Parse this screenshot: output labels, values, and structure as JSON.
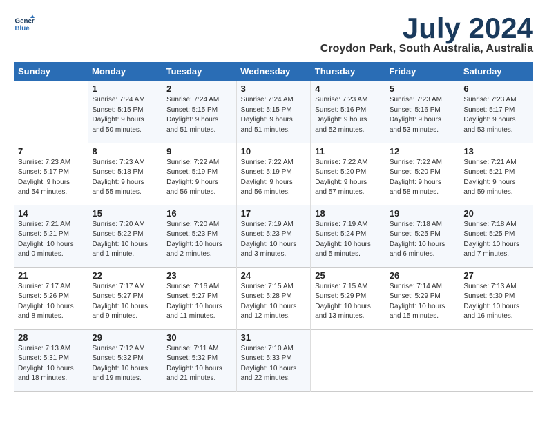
{
  "logo": {
    "line1": "General",
    "line2": "Blue"
  },
  "title": "July 2024",
  "location": "Croydon Park, South Australia, Australia",
  "days_of_week": [
    "Sunday",
    "Monday",
    "Tuesday",
    "Wednesday",
    "Thursday",
    "Friday",
    "Saturday"
  ],
  "weeks": [
    [
      {
        "day": "",
        "info": ""
      },
      {
        "day": "1",
        "info": "Sunrise: 7:24 AM\nSunset: 5:15 PM\nDaylight: 9 hours\nand 50 minutes."
      },
      {
        "day": "2",
        "info": "Sunrise: 7:24 AM\nSunset: 5:15 PM\nDaylight: 9 hours\nand 51 minutes."
      },
      {
        "day": "3",
        "info": "Sunrise: 7:24 AM\nSunset: 5:15 PM\nDaylight: 9 hours\nand 51 minutes."
      },
      {
        "day": "4",
        "info": "Sunrise: 7:23 AM\nSunset: 5:16 PM\nDaylight: 9 hours\nand 52 minutes."
      },
      {
        "day": "5",
        "info": "Sunrise: 7:23 AM\nSunset: 5:16 PM\nDaylight: 9 hours\nand 53 minutes."
      },
      {
        "day": "6",
        "info": "Sunrise: 7:23 AM\nSunset: 5:17 PM\nDaylight: 9 hours\nand 53 minutes."
      }
    ],
    [
      {
        "day": "7",
        "info": "Sunrise: 7:23 AM\nSunset: 5:17 PM\nDaylight: 9 hours\nand 54 minutes."
      },
      {
        "day": "8",
        "info": "Sunrise: 7:23 AM\nSunset: 5:18 PM\nDaylight: 9 hours\nand 55 minutes."
      },
      {
        "day": "9",
        "info": "Sunrise: 7:22 AM\nSunset: 5:19 PM\nDaylight: 9 hours\nand 56 minutes."
      },
      {
        "day": "10",
        "info": "Sunrise: 7:22 AM\nSunset: 5:19 PM\nDaylight: 9 hours\nand 56 minutes."
      },
      {
        "day": "11",
        "info": "Sunrise: 7:22 AM\nSunset: 5:20 PM\nDaylight: 9 hours\nand 57 minutes."
      },
      {
        "day": "12",
        "info": "Sunrise: 7:22 AM\nSunset: 5:20 PM\nDaylight: 9 hours\nand 58 minutes."
      },
      {
        "day": "13",
        "info": "Sunrise: 7:21 AM\nSunset: 5:21 PM\nDaylight: 9 hours\nand 59 minutes."
      }
    ],
    [
      {
        "day": "14",
        "info": "Sunrise: 7:21 AM\nSunset: 5:21 PM\nDaylight: 10 hours\nand 0 minutes."
      },
      {
        "day": "15",
        "info": "Sunrise: 7:20 AM\nSunset: 5:22 PM\nDaylight: 10 hours\nand 1 minute."
      },
      {
        "day": "16",
        "info": "Sunrise: 7:20 AM\nSunset: 5:23 PM\nDaylight: 10 hours\nand 2 minutes."
      },
      {
        "day": "17",
        "info": "Sunrise: 7:19 AM\nSunset: 5:23 PM\nDaylight: 10 hours\nand 3 minutes."
      },
      {
        "day": "18",
        "info": "Sunrise: 7:19 AM\nSunset: 5:24 PM\nDaylight: 10 hours\nand 5 minutes."
      },
      {
        "day": "19",
        "info": "Sunrise: 7:18 AM\nSunset: 5:25 PM\nDaylight: 10 hours\nand 6 minutes."
      },
      {
        "day": "20",
        "info": "Sunrise: 7:18 AM\nSunset: 5:25 PM\nDaylight: 10 hours\nand 7 minutes."
      }
    ],
    [
      {
        "day": "21",
        "info": "Sunrise: 7:17 AM\nSunset: 5:26 PM\nDaylight: 10 hours\nand 8 minutes."
      },
      {
        "day": "22",
        "info": "Sunrise: 7:17 AM\nSunset: 5:27 PM\nDaylight: 10 hours\nand 9 minutes."
      },
      {
        "day": "23",
        "info": "Sunrise: 7:16 AM\nSunset: 5:27 PM\nDaylight: 10 hours\nand 11 minutes."
      },
      {
        "day": "24",
        "info": "Sunrise: 7:15 AM\nSunset: 5:28 PM\nDaylight: 10 hours\nand 12 minutes."
      },
      {
        "day": "25",
        "info": "Sunrise: 7:15 AM\nSunset: 5:29 PM\nDaylight: 10 hours\nand 13 minutes."
      },
      {
        "day": "26",
        "info": "Sunrise: 7:14 AM\nSunset: 5:29 PM\nDaylight: 10 hours\nand 15 minutes."
      },
      {
        "day": "27",
        "info": "Sunrise: 7:13 AM\nSunset: 5:30 PM\nDaylight: 10 hours\nand 16 minutes."
      }
    ],
    [
      {
        "day": "28",
        "info": "Sunrise: 7:13 AM\nSunset: 5:31 PM\nDaylight: 10 hours\nand 18 minutes."
      },
      {
        "day": "29",
        "info": "Sunrise: 7:12 AM\nSunset: 5:32 PM\nDaylight: 10 hours\nand 19 minutes."
      },
      {
        "day": "30",
        "info": "Sunrise: 7:11 AM\nSunset: 5:32 PM\nDaylight: 10 hours\nand 21 minutes."
      },
      {
        "day": "31",
        "info": "Sunrise: 7:10 AM\nSunset: 5:33 PM\nDaylight: 10 hours\nand 22 minutes."
      },
      {
        "day": "",
        "info": ""
      },
      {
        "day": "",
        "info": ""
      },
      {
        "day": "",
        "info": ""
      }
    ]
  ]
}
